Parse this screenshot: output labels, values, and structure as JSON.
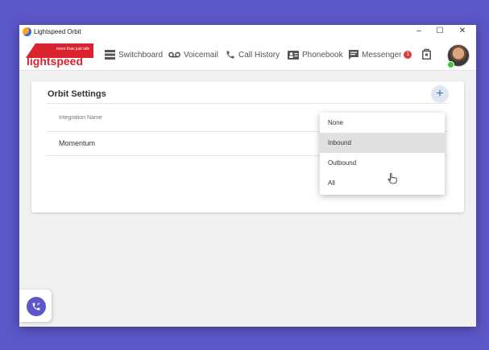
{
  "window": {
    "title": "Lightspeed Orbit",
    "controls": {
      "minimize": "–",
      "maximize": "☐",
      "close": "✕"
    }
  },
  "brand": {
    "tagline": "more than just talk",
    "name": "lightspeed"
  },
  "nav": {
    "items": [
      {
        "label": "Switchboard",
        "icon": "switchboard-icon"
      },
      {
        "label": "Voicemail",
        "icon": "voicemail-icon"
      },
      {
        "label": "Call History",
        "icon": "phone-icon"
      },
      {
        "label": "Phonebook",
        "icon": "contact-card-icon"
      },
      {
        "label": "Messenger",
        "icon": "chat-icon",
        "badge": "1"
      }
    ],
    "presence_color": "#3ec43e"
  },
  "settings_card": {
    "title": "Orbit Settings",
    "add_label": "+",
    "column_header": "Integration Name",
    "rows": [
      {
        "name": "Momentum"
      }
    ]
  },
  "dropdown": {
    "options": [
      "None",
      "Inbound",
      "Outbound",
      "All"
    ],
    "hovered": "Inbound"
  },
  "colors": {
    "accent": "#5b57c8",
    "badge": "#e53935",
    "brand_red": "#d9232e"
  }
}
